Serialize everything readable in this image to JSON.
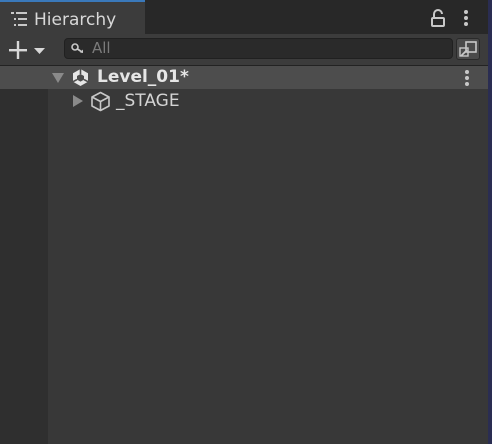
{
  "window": {
    "tab_title": "Hierarchy",
    "tab_icon": "hierarchy-list-icon",
    "accent_color": "#3a79bb"
  },
  "toolbar": {
    "add_icon": "plus-icon",
    "search": {
      "value": "",
      "placeholder": "All",
      "icon": "search-icon"
    },
    "search_mode_icon": "search-mode-icon"
  },
  "hierarchy": {
    "scene": {
      "name": "Level_01*",
      "expanded": true,
      "icon": "unity-scene-icon"
    },
    "items": [
      {
        "name": "_STAGE",
        "expanded": false,
        "icon": "cube-icon"
      }
    ]
  }
}
